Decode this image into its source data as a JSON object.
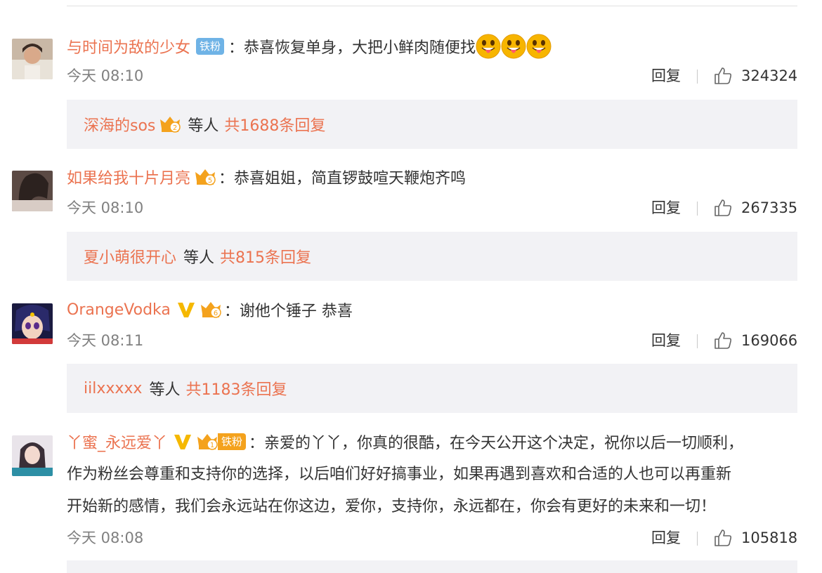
{
  "comments": [
    {
      "username": "与时间为敌的少女",
      "badge": "铁粉",
      "text": "：恭喜恢复单身，大把小鲜肉随便找",
      "emoji": "tongue-face-emoji",
      "time": "今天 08:10",
      "reply_label": "回复",
      "likes": "324324",
      "reply_box": {
        "user": "深海的sos",
        "crown_level": "2",
        "mid": "等人",
        "total": "共1688条回复"
      }
    },
    {
      "username": "如果给我十片月亮",
      "crown_level": "5",
      "text": "：恭喜姐姐，简直锣鼓喧天鞭炮齐鸣",
      "time": "今天 08:10",
      "reply_label": "回复",
      "likes": "267335",
      "reply_box": {
        "user": "夏小萌很开心",
        "mid": "等人",
        "total": "共815条回复"
      }
    },
    {
      "username": "OrangeVodka",
      "crown_level": "6",
      "text": "：谢他个锤子 恭喜",
      "time": "今天 08:11",
      "reply_label": "回复",
      "likes": "169066",
      "reply_box": {
        "user": "iilxxxxx",
        "mid": "等人",
        "total": "共1183条回复"
      }
    },
    {
      "username": "丫蜜_永远爱丫",
      "crown_level": "1",
      "badge": "铁粉",
      "text_line1": "：亲爱的丫丫，你真的很酷，在今天公开这个决定，祝你以后一切顺利，",
      "text_line2": "作为粉丝会尊重和支持你的选择，以后咱们好好搞事业，如果再遇到喜欢和合适的人也可以再重新",
      "text_line3": "开始新的感情，我们会永远站在你这边，爱你，支持你，永远都在，你会有更好的未来和一切！",
      "time": "今天 08:08",
      "reply_label": "回复",
      "likes": "105818"
    }
  ],
  "colors": {
    "username": "#eb7350",
    "reply_box_bg": "#f2f2f5",
    "time": "#808080",
    "badge": "#6fb3e6",
    "crown": "#f4a21d",
    "verified": "#f5b800"
  },
  "icons": [
    "thumbs-up-icon",
    "crown-icon",
    "verified-v-icon",
    "tongue-face-emoji"
  ]
}
